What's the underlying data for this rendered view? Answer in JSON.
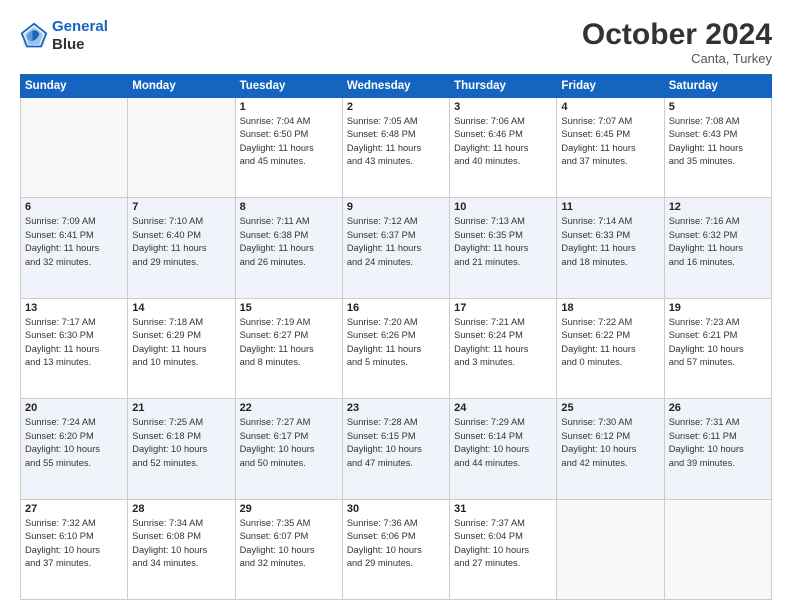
{
  "header": {
    "logo_line1": "General",
    "logo_line2": "Blue",
    "month": "October 2024",
    "location": "Canta, Turkey"
  },
  "weekdays": [
    "Sunday",
    "Monday",
    "Tuesday",
    "Wednesday",
    "Thursday",
    "Friday",
    "Saturday"
  ],
  "weeks": [
    [
      {
        "day": "",
        "info": ""
      },
      {
        "day": "",
        "info": ""
      },
      {
        "day": "1",
        "info": "Sunrise: 7:04 AM\nSunset: 6:50 PM\nDaylight: 11 hours\nand 45 minutes."
      },
      {
        "day": "2",
        "info": "Sunrise: 7:05 AM\nSunset: 6:48 PM\nDaylight: 11 hours\nand 43 minutes."
      },
      {
        "day": "3",
        "info": "Sunrise: 7:06 AM\nSunset: 6:46 PM\nDaylight: 11 hours\nand 40 minutes."
      },
      {
        "day": "4",
        "info": "Sunrise: 7:07 AM\nSunset: 6:45 PM\nDaylight: 11 hours\nand 37 minutes."
      },
      {
        "day": "5",
        "info": "Sunrise: 7:08 AM\nSunset: 6:43 PM\nDaylight: 11 hours\nand 35 minutes."
      }
    ],
    [
      {
        "day": "6",
        "info": "Sunrise: 7:09 AM\nSunset: 6:41 PM\nDaylight: 11 hours\nand 32 minutes."
      },
      {
        "day": "7",
        "info": "Sunrise: 7:10 AM\nSunset: 6:40 PM\nDaylight: 11 hours\nand 29 minutes."
      },
      {
        "day": "8",
        "info": "Sunrise: 7:11 AM\nSunset: 6:38 PM\nDaylight: 11 hours\nand 26 minutes."
      },
      {
        "day": "9",
        "info": "Sunrise: 7:12 AM\nSunset: 6:37 PM\nDaylight: 11 hours\nand 24 minutes."
      },
      {
        "day": "10",
        "info": "Sunrise: 7:13 AM\nSunset: 6:35 PM\nDaylight: 11 hours\nand 21 minutes."
      },
      {
        "day": "11",
        "info": "Sunrise: 7:14 AM\nSunset: 6:33 PM\nDaylight: 11 hours\nand 18 minutes."
      },
      {
        "day": "12",
        "info": "Sunrise: 7:16 AM\nSunset: 6:32 PM\nDaylight: 11 hours\nand 16 minutes."
      }
    ],
    [
      {
        "day": "13",
        "info": "Sunrise: 7:17 AM\nSunset: 6:30 PM\nDaylight: 11 hours\nand 13 minutes."
      },
      {
        "day": "14",
        "info": "Sunrise: 7:18 AM\nSunset: 6:29 PM\nDaylight: 11 hours\nand 10 minutes."
      },
      {
        "day": "15",
        "info": "Sunrise: 7:19 AM\nSunset: 6:27 PM\nDaylight: 11 hours\nand 8 minutes."
      },
      {
        "day": "16",
        "info": "Sunrise: 7:20 AM\nSunset: 6:26 PM\nDaylight: 11 hours\nand 5 minutes."
      },
      {
        "day": "17",
        "info": "Sunrise: 7:21 AM\nSunset: 6:24 PM\nDaylight: 11 hours\nand 3 minutes."
      },
      {
        "day": "18",
        "info": "Sunrise: 7:22 AM\nSunset: 6:22 PM\nDaylight: 11 hours\nand 0 minutes."
      },
      {
        "day": "19",
        "info": "Sunrise: 7:23 AM\nSunset: 6:21 PM\nDaylight: 10 hours\nand 57 minutes."
      }
    ],
    [
      {
        "day": "20",
        "info": "Sunrise: 7:24 AM\nSunset: 6:20 PM\nDaylight: 10 hours\nand 55 minutes."
      },
      {
        "day": "21",
        "info": "Sunrise: 7:25 AM\nSunset: 6:18 PM\nDaylight: 10 hours\nand 52 minutes."
      },
      {
        "day": "22",
        "info": "Sunrise: 7:27 AM\nSunset: 6:17 PM\nDaylight: 10 hours\nand 50 minutes."
      },
      {
        "day": "23",
        "info": "Sunrise: 7:28 AM\nSunset: 6:15 PM\nDaylight: 10 hours\nand 47 minutes."
      },
      {
        "day": "24",
        "info": "Sunrise: 7:29 AM\nSunset: 6:14 PM\nDaylight: 10 hours\nand 44 minutes."
      },
      {
        "day": "25",
        "info": "Sunrise: 7:30 AM\nSunset: 6:12 PM\nDaylight: 10 hours\nand 42 minutes."
      },
      {
        "day": "26",
        "info": "Sunrise: 7:31 AM\nSunset: 6:11 PM\nDaylight: 10 hours\nand 39 minutes."
      }
    ],
    [
      {
        "day": "27",
        "info": "Sunrise: 7:32 AM\nSunset: 6:10 PM\nDaylight: 10 hours\nand 37 minutes."
      },
      {
        "day": "28",
        "info": "Sunrise: 7:34 AM\nSunset: 6:08 PM\nDaylight: 10 hours\nand 34 minutes."
      },
      {
        "day": "29",
        "info": "Sunrise: 7:35 AM\nSunset: 6:07 PM\nDaylight: 10 hours\nand 32 minutes."
      },
      {
        "day": "30",
        "info": "Sunrise: 7:36 AM\nSunset: 6:06 PM\nDaylight: 10 hours\nand 29 minutes."
      },
      {
        "day": "31",
        "info": "Sunrise: 7:37 AM\nSunset: 6:04 PM\nDaylight: 10 hours\nand 27 minutes."
      },
      {
        "day": "",
        "info": ""
      },
      {
        "day": "",
        "info": ""
      }
    ]
  ]
}
